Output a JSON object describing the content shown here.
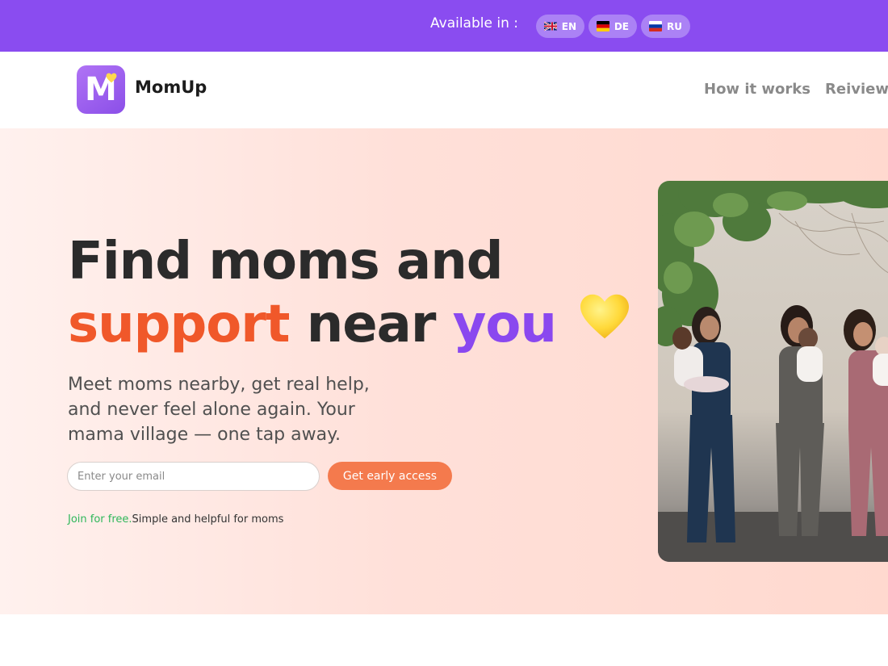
{
  "lang_bar": {
    "label": "Available in :",
    "languages": [
      {
        "code": "EN",
        "flag": "uk-flag-icon"
      },
      {
        "code": "DE",
        "flag": "germany-flag-icon"
      },
      {
        "code": "RU",
        "flag": "russia-flag-icon"
      }
    ],
    "background_color": "#8a4cf0"
  },
  "header": {
    "logo_letter": "M",
    "brand_name": "MomUp",
    "nav": [
      "How it works",
      "Reiview"
    ]
  },
  "hero": {
    "headline": {
      "line1": "Find moms and",
      "word_orange": "support",
      "word_dark": "near",
      "word_purple": "you"
    },
    "subtext": "Meet moms nearby, get real help, and never feel alone again. Your mama village — one tap away.",
    "email_placeholder": "Enter your email",
    "cta_label": "Get early access",
    "footnote_green": "Join for free.",
    "footnote_rest": "Simple and helpful for moms",
    "colors": {
      "orange": "#f0582a",
      "purple": "#8a48ef",
      "cta": "#f47a4d",
      "green": "#2fb75a"
    }
  },
  "photo": {
    "icon": "moms-with-babies-photo"
  }
}
